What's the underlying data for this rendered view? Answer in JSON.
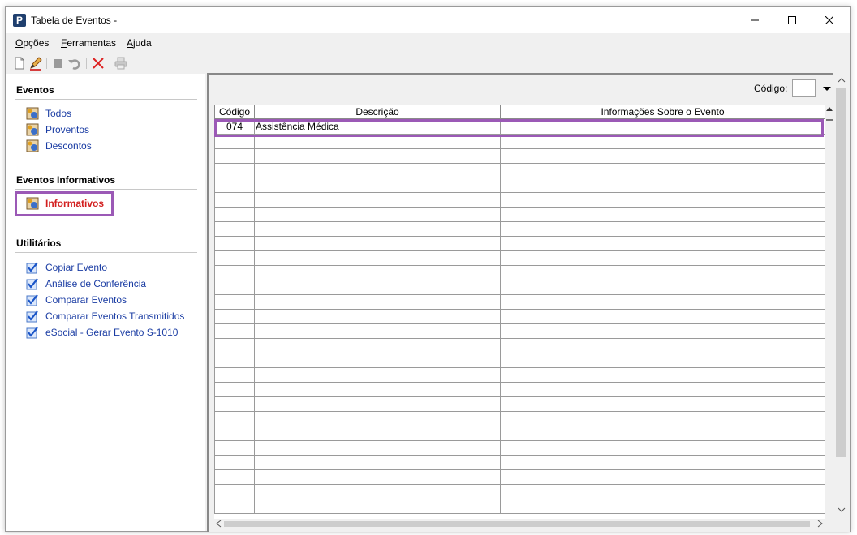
{
  "window": {
    "title": "Tabela de Eventos -"
  },
  "menu": [
    {
      "label": "Opções",
      "accel": "O"
    },
    {
      "label": "Ferramentas",
      "accel": "F"
    },
    {
      "label": "Ajuda",
      "accel": "A"
    }
  ],
  "toolbar": {
    "buttons": [
      "new-document-icon",
      "edit-pencil-icon",
      "stop-icon",
      "undo-icon",
      "delete-x-icon",
      "print-icon"
    ]
  },
  "sidebar": {
    "sections": [
      {
        "title": "Eventos",
        "items": [
          {
            "label": "Todos",
            "icon": "events-icon"
          },
          {
            "label": "Proventos",
            "icon": "events-icon"
          },
          {
            "label": "Descontos",
            "icon": "events-icon"
          }
        ]
      },
      {
        "title": "Eventos Informativos",
        "items": [
          {
            "label": "Informativos",
            "icon": "events-icon",
            "selected": true
          }
        ]
      },
      {
        "title": "Utilitários",
        "items": [
          {
            "label": "Copiar Evento",
            "icon": "checkmark-icon"
          },
          {
            "label": "Análise de Conferência",
            "icon": "checkmark-icon"
          },
          {
            "label": "Comparar Eventos",
            "icon": "checkmark-icon"
          },
          {
            "label": "Comparar Eventos Transmitidos",
            "icon": "checkmark-icon"
          },
          {
            "label": "eSocial - Gerar Evento S-1010",
            "icon": "checkmark-icon"
          }
        ]
      }
    ]
  },
  "filter": {
    "codigo_label": "Código:",
    "codigo_value": ""
  },
  "grid": {
    "columns": [
      "Código",
      "Descrição",
      "Informações Sobre o Evento"
    ],
    "rows": [
      [
        "074",
        "Assistência Médica",
        ""
      ]
    ],
    "empty_rows": 26
  },
  "colors": {
    "highlight": "#9b59b6",
    "link": "#1a3ca3",
    "selected": "#d21f1f"
  }
}
